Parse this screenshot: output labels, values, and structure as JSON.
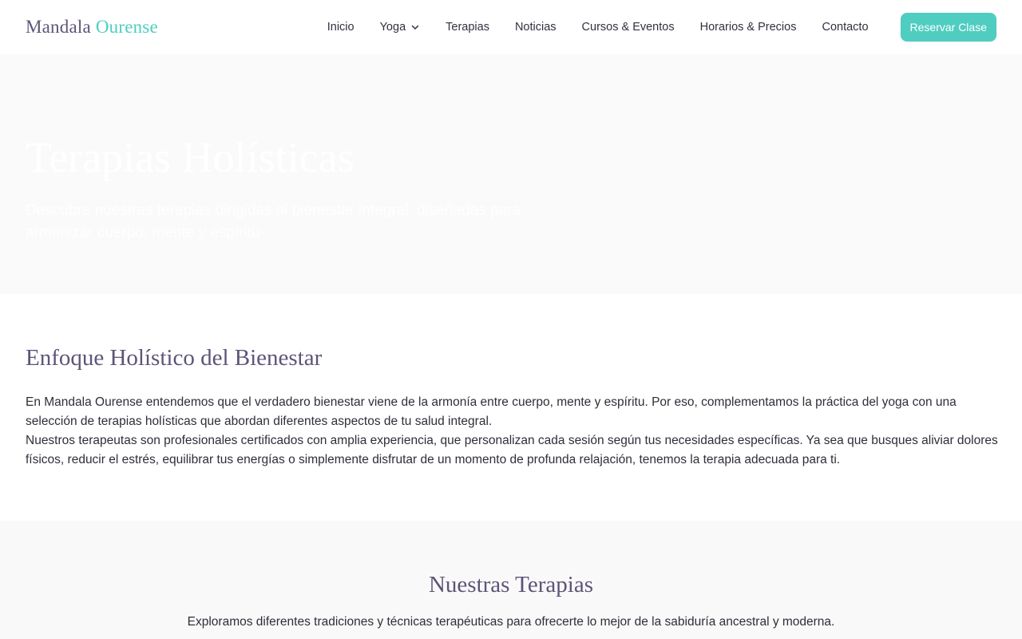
{
  "brand": {
    "name_part1": "Mandala",
    "name_part2": "Ourense",
    "color_primary": "#5e5478",
    "color_accent": "#4fcdc0"
  },
  "nav": {
    "items": [
      {
        "label": "Inicio"
      },
      {
        "label": "Yoga",
        "icon": "chevron-down-icon"
      },
      {
        "label": "Terapias"
      },
      {
        "label": "Noticias"
      },
      {
        "label": "Cursos & Eventos"
      },
      {
        "label": "Horarios & Precios"
      },
      {
        "label": "Contacto"
      }
    ],
    "cta_label": "Reservar Clase"
  },
  "hero": {
    "title": "Terapias Holísticas",
    "subtitle": "Descubre nuestras terapias dirigidas al bienestar integral, diseñadas para armonizar cuerpo, mente y espíritu"
  },
  "approach": {
    "title": "Enfoque Holístico del Bienestar",
    "paragraph1": "En Mandala Ourense entendemos que el verdadero bienestar viene de la armonía entre cuerpo, mente y espíritu. Por eso, complementamos la práctica del yoga con una selección de terapias holísticas que abordan diferentes aspectos de tu salud integral.",
    "paragraph2": "Nuestros terapeutas son profesionales certificados con amplia experiencia, que personalizan cada sesión según tus necesidades específicas. Ya sea que busques aliviar dolores físicos, reducir el estrés, equilibrar tus energías o simplemente disfrutar de un momento de profunda relajación, tenemos la terapia adecuada para ti."
  },
  "therapies": {
    "title": "Nuestras Terapias",
    "intro": "Exploramos diferentes tradiciones y técnicas terapéuticas para ofrecerte lo mejor de la sabiduría ancestral y moderna."
  }
}
